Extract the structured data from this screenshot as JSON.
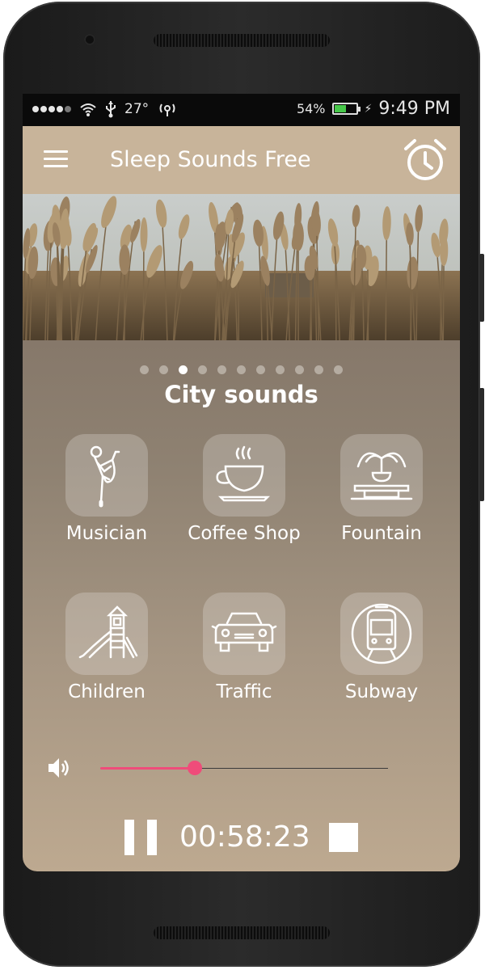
{
  "status_bar": {
    "temperature": "27°",
    "battery_percent": "54%",
    "battery_level": 0.54,
    "time": "9:49 PM",
    "icons": [
      "signal-dots-icon",
      "wifi-icon",
      "usb-icon",
      "temperature-text",
      "wireless-signal-icon",
      "battery-icon"
    ]
  },
  "app_bar": {
    "title": "Sleep Sounds Free",
    "menu_icon": "hamburger-menu-icon",
    "alarm_icon": "alarm-clock-icon"
  },
  "category": {
    "title": "City sounds",
    "page_count": 11,
    "active_page_index": 2
  },
  "sounds": [
    {
      "label": "Musician",
      "icon": "saxophone-player-icon"
    },
    {
      "label": "Coffee Shop",
      "icon": "coffee-cup-icon"
    },
    {
      "label": "Fountain",
      "icon": "fountain-icon"
    },
    {
      "label": "Children",
      "icon": "playground-slide-icon"
    },
    {
      "label": "Traffic",
      "icon": "car-icon"
    },
    {
      "label": "Subway",
      "icon": "subway-train-icon"
    }
  ],
  "player": {
    "volume_icon": "speaker-volume-icon",
    "volume_level": 0.33,
    "timer": "00:58:23",
    "pause_icon": "pause-icon",
    "stop_icon": "stop-icon"
  },
  "colors": {
    "app_bar": "#c8b49a",
    "slider_accent": "#ef4c7a",
    "battery_fill": "#47c84a"
  }
}
